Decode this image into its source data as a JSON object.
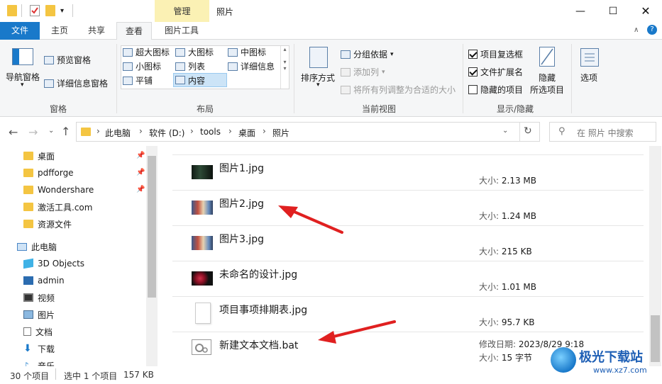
{
  "titlebar": {
    "context_tab": "管理",
    "title": "照片",
    "controls": [
      "minimize",
      "maximize",
      "close"
    ]
  },
  "tabs": [
    {
      "label": "文件"
    },
    {
      "label": "主页"
    },
    {
      "label": "共享"
    },
    {
      "label": "查看",
      "active": true
    },
    {
      "label": "图片工具"
    }
  ],
  "ribbon": {
    "pane": {
      "nav_pane": "导航窗格",
      "preview_pane": "预览窗格",
      "details_pane": "详细信息窗格",
      "group": "窗格"
    },
    "layout": {
      "options": [
        "超大图标",
        "大图标",
        "中图标",
        "小图标",
        "列表",
        "详细信息",
        "平铺",
        "内容"
      ],
      "selected": "内容",
      "group": "布局"
    },
    "current_view": {
      "sort_by": "排序方式",
      "group_by": "分组依据",
      "add_column": "添加列",
      "fit_columns": "将所有列调整为合适的大小",
      "group": "当前视图"
    },
    "show_hide": {
      "item_checkboxes": "项目复选框",
      "file_extensions": "文件扩展名",
      "hidden_items": "隐藏的项目",
      "item_checkboxes_checked": true,
      "file_extensions_checked": true,
      "hidden_items_checked": false,
      "hide_selected": "隐藏\n所选项目",
      "hide_label": "隐藏",
      "selected_label": "所选项目",
      "group": "显示/隐藏"
    },
    "options": "选项"
  },
  "address": {
    "crumbs": [
      "此电脑",
      "软件 (D:)",
      "tools",
      "桌面",
      "照片"
    ],
    "search_placeholder": "在 照片 中搜索"
  },
  "sidebar": {
    "items": [
      {
        "label": "桌面",
        "pinned": true,
        "icon": "folder-icon"
      },
      {
        "label": "pdfforge",
        "pinned": true,
        "icon": "folder-icon"
      },
      {
        "label": "Wondershare",
        "pinned": true,
        "icon": "folder-icon"
      },
      {
        "label": "激活工具.com",
        "icon": "folder-icon"
      },
      {
        "label": "资源文件",
        "icon": "folder-icon"
      },
      {
        "label": "此电脑",
        "icon": "pc-icon"
      },
      {
        "label": "3D Objects",
        "icon": "cube-icon"
      },
      {
        "label": "admin",
        "icon": "user-folder-icon"
      },
      {
        "label": "视频",
        "icon": "video-icon"
      },
      {
        "label": "图片",
        "icon": "pictures-icon"
      },
      {
        "label": "文档",
        "icon": "document-icon"
      },
      {
        "label": "下载",
        "icon": "download-icon"
      },
      {
        "label": "音乐",
        "icon": "music-icon"
      }
    ]
  },
  "files": [
    {
      "name": "图片1.jpg",
      "size_label": "大小:",
      "size": "2.13 MB",
      "thumb": "photo-dark"
    },
    {
      "name": "图片2.jpg",
      "size_label": "大小:",
      "size": "1.24 MB",
      "thumb": "photo-people"
    },
    {
      "name": "图片3.jpg",
      "size_label": "大小:",
      "size": "215 KB",
      "thumb": "photo-people"
    },
    {
      "name": "未命名的设计.jpg",
      "size_label": "大小:",
      "size": "1.01 MB",
      "thumb": "photo-red"
    },
    {
      "name": "项目事项排期表.jpg",
      "size_label": "大小:",
      "size": "95.7 KB",
      "thumb": "document"
    },
    {
      "name": "新建文本文档.bat",
      "date_label": "修改日期:",
      "date": "2023/8/29 9:18",
      "size_label": "大小:",
      "size": "15 字节",
      "thumb": "gear-file"
    }
  ],
  "status": {
    "count": "30 个项目",
    "selected": "选中 1 个项目",
    "selected_size": "157 KB"
  },
  "watermark": {
    "text": "极光下载站",
    "url": "www.xz7.com"
  },
  "colors": {
    "file_tab": "#1979ca",
    "context_tab": "#fbf1b4",
    "arrow": "#e02020",
    "folder": "#f4c542"
  }
}
